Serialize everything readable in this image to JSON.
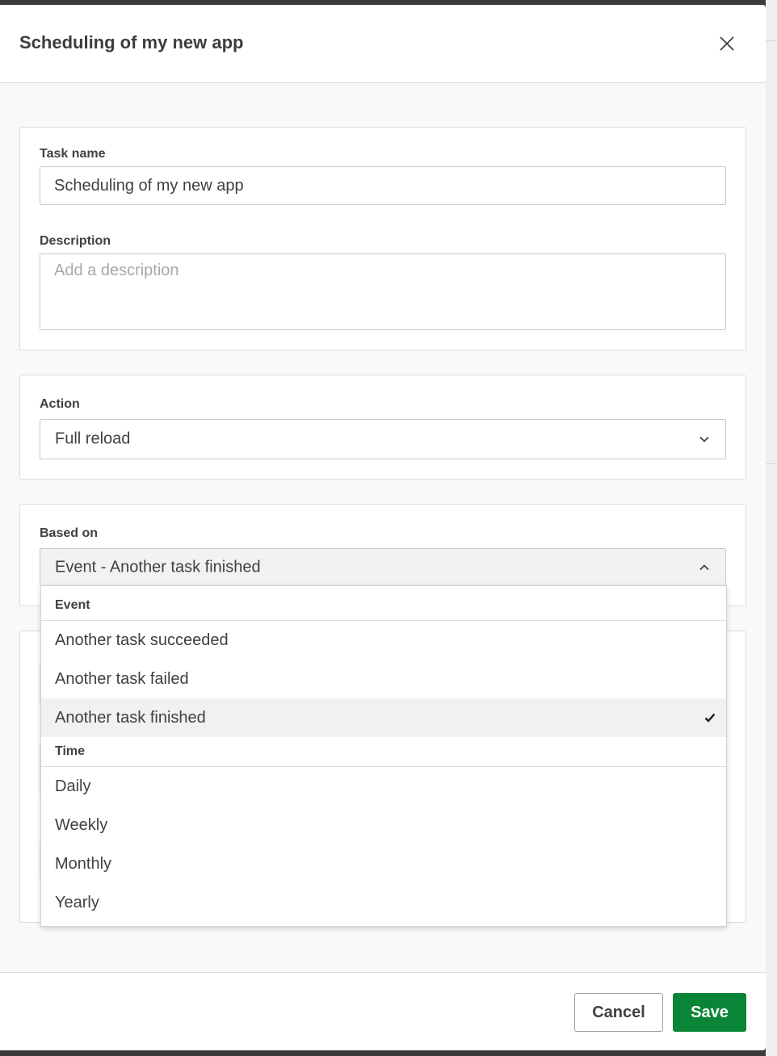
{
  "dialog": {
    "title": "Scheduling of my new app"
  },
  "task_section": {
    "task_name_label": "Task name",
    "task_name_value": "Scheduling of my new app",
    "description_label": "Description",
    "description_placeholder": "Add a description"
  },
  "action_section": {
    "label": "Action",
    "selected": "Full reload"
  },
  "based_on_section": {
    "label": "Based on",
    "selected": "Event - Another task finished"
  },
  "dropdown": {
    "groups": [
      {
        "header": "Event",
        "options": [
          "Another task succeeded",
          "Another task failed",
          "Another task finished"
        ]
      },
      {
        "header": "Time",
        "options": [
          "Daily",
          "Weekly",
          "Monthly",
          "Yearly"
        ]
      }
    ],
    "selected_option": "Another task finished"
  },
  "footer": {
    "cancel_label": "Cancel",
    "save_label": "Save"
  },
  "colors": {
    "save_button": "#0a8537",
    "selected_row": "#f1f1f1",
    "dialog_background": "#f9f9f9"
  },
  "icons": {
    "close": "close-icon",
    "chevron_down": "chevron-down-icon",
    "chevron_up": "chevron-up-icon",
    "check": "check-icon"
  }
}
